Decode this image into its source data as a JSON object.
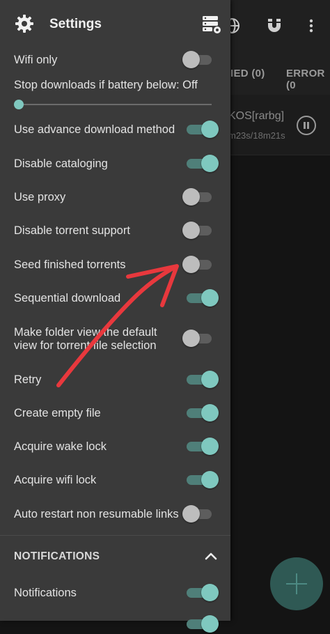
{
  "background": {
    "tabs": [
      "IED (0)",
      "ERROR (0"
    ],
    "row_title": "KOS[rarbg]",
    "row_sub": "m23s/18m21s"
  },
  "drawer": {
    "title": "Settings",
    "items": [
      {
        "label": "Wifi only",
        "on": false
      },
      {
        "label": "Stop downloads if battery below: Off"
      },
      {
        "label": "Use advance download method",
        "on": true
      },
      {
        "label": "Disable cataloging",
        "on": true
      },
      {
        "label": "Use proxy",
        "on": false
      },
      {
        "label": "Disable torrent support",
        "on": false
      },
      {
        "label": "Seed finished torrents",
        "on": false
      },
      {
        "label": "Sequential download",
        "on": true
      },
      {
        "label": "Make folder view the default",
        "label2": "view for torrent file selection",
        "on": false
      },
      {
        "label": "Retry",
        "on": true
      },
      {
        "label": "Create empty file",
        "on": true
      },
      {
        "label": "Acquire wake lock",
        "on": true
      },
      {
        "label": "Acquire wifi lock",
        "on": true
      },
      {
        "label": "Auto restart non resumable links",
        "on": false
      }
    ],
    "slider_value": 0,
    "notifications_section": "NOTIFICATIONS",
    "notifications_item": {
      "label": "Notifications",
      "on": true
    }
  },
  "colors": {
    "accent": "#7fc8bf",
    "annotation_arrow": "#e8383d"
  }
}
